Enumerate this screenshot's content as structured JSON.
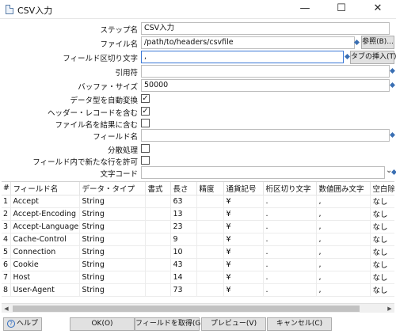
{
  "window": {
    "title": "CSV入力",
    "minimize": "—",
    "maximize": "☐",
    "close": "✕"
  },
  "form": {
    "step_name_label": "ステップ名",
    "step_name_value": "CSV入力",
    "filename_label": "ファイル名",
    "filename_value": "/path/to/headers/csvfile",
    "browse_button": "参照(B)...",
    "delimiter_label": "フィールド区切り文字",
    "delimiter_value": ",",
    "insert_tab_button": "タブの挿入(T)",
    "enclosure_label": "引用符",
    "enclosure_value": "",
    "buffer_size_label": "バッファ・サイズ",
    "buffer_size_value": "50000",
    "lazy_conversion_label": "データ型を自動変換",
    "lazy_conversion_checked": "✓",
    "header_row_label": "ヘッダー・レコードを含む",
    "header_row_checked": "✓",
    "add_filename_label": "ファイル名を結果に含む",
    "add_filename_checked": "",
    "field_name_label": "フィールド名",
    "field_name_value": "",
    "parallel_label": "分散処理",
    "parallel_checked": "",
    "newline_label": "フィールド内で新たな行を許可",
    "newline_checked": "",
    "encoding_label": "文字コード",
    "encoding_value": "",
    "encoding_arrow": "⌄"
  },
  "table": {
    "headers": [
      "#",
      "フィールド名",
      "データ・タイプ",
      "書式",
      "長さ",
      "精度",
      "通貨記号",
      "桁区切り文字",
      "数値囲み文字",
      "空白除去"
    ],
    "rows": [
      [
        "1",
        "Accept",
        "String",
        "",
        "63",
        "",
        "¥",
        ".",
        ",",
        "なし"
      ],
      [
        "2",
        "Accept-Encoding",
        "String",
        "",
        "13",
        "",
        "¥",
        ".",
        ",",
        "なし"
      ],
      [
        "3",
        "Accept-Language",
        "String",
        "",
        "23",
        "",
        "¥",
        ".",
        ",",
        "なし"
      ],
      [
        "4",
        "Cache-Control",
        "String",
        "",
        "9",
        "",
        "¥",
        ".",
        ",",
        "なし"
      ],
      [
        "5",
        "Connection",
        "String",
        "",
        "10",
        "",
        "¥",
        ".",
        ",",
        "なし"
      ],
      [
        "6",
        "Cookie",
        "String",
        "",
        "43",
        "",
        "¥",
        ".",
        ",",
        "なし"
      ],
      [
        "7",
        "Host",
        "String",
        "",
        "14",
        "",
        "¥",
        ".",
        ",",
        "なし"
      ],
      [
        "8",
        "User-Agent",
        "String",
        "",
        "73",
        "",
        "¥",
        ".",
        ",",
        "なし"
      ]
    ]
  },
  "buttons": {
    "help": "ヘルプ",
    "ok": "OK(O)",
    "get_fields": "フィールドを取得(G)",
    "preview": "プレビュー(V)",
    "cancel": "キャンセル(C)"
  }
}
